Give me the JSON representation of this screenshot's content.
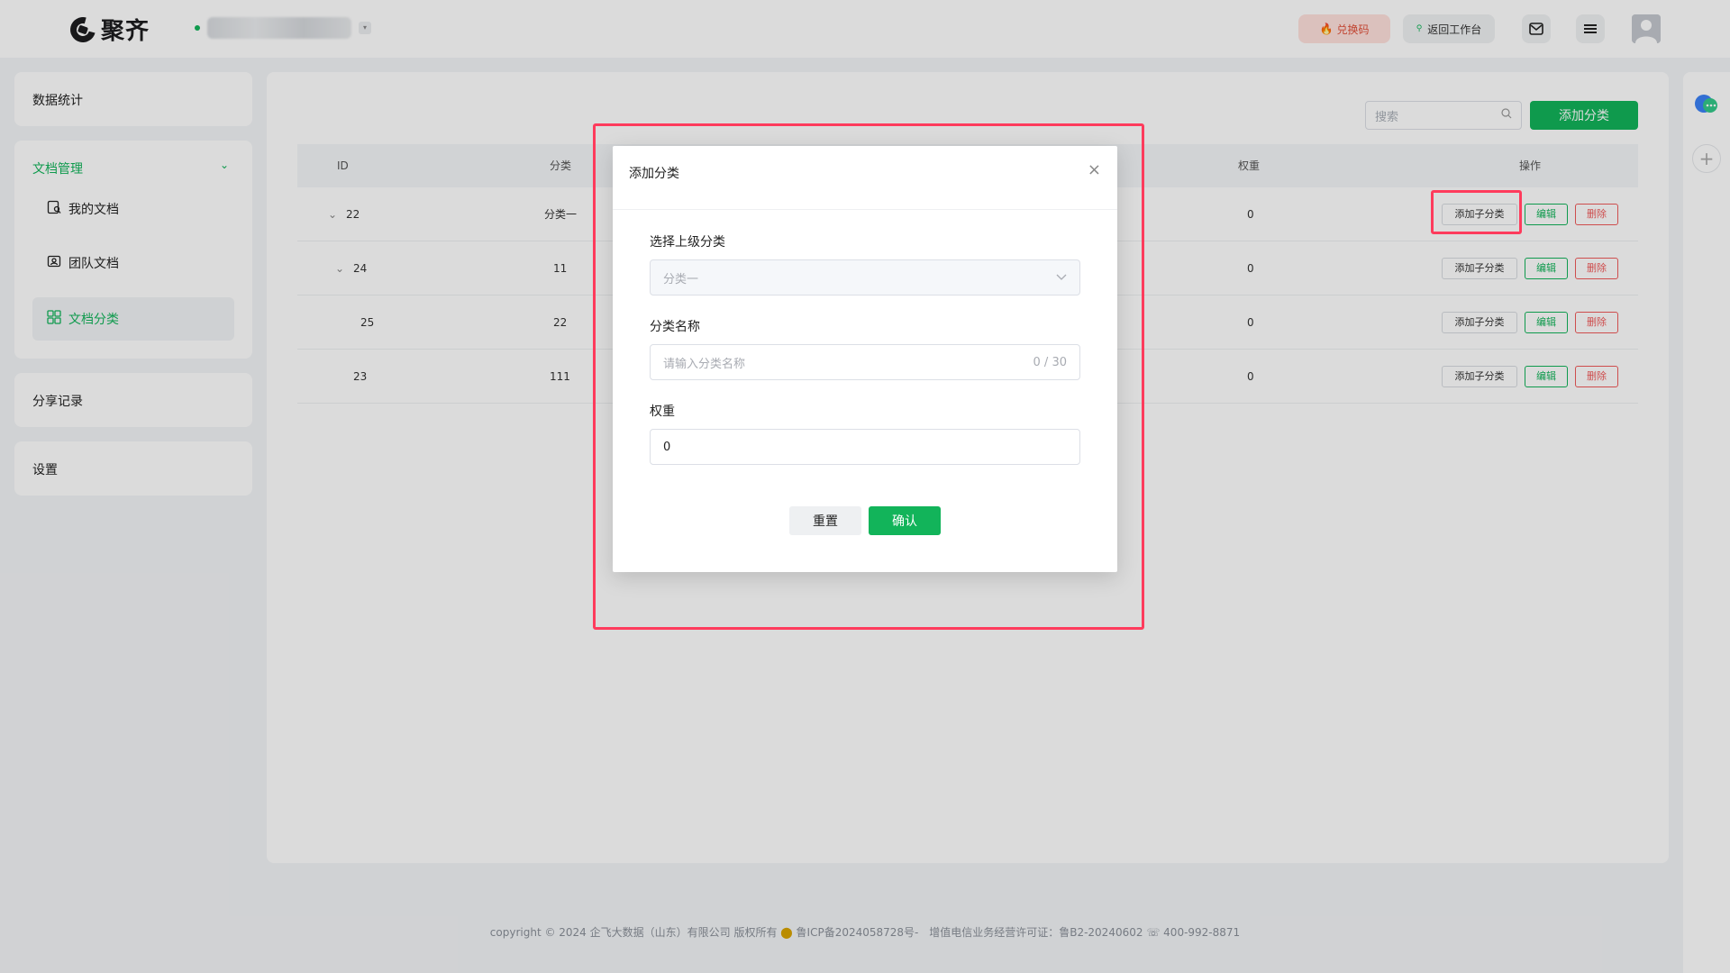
{
  "header": {
    "brand": "聚齐",
    "redeem_label": "兑换码",
    "back_label": "返回工作台"
  },
  "sidebar": {
    "stats": "数据统计",
    "doc_mgmt": "文档管理",
    "my_docs": "我的文档",
    "team_docs": "团队文档",
    "doc_category": "文档分类",
    "share_records": "分享记录",
    "settings": "设置"
  },
  "toolbar": {
    "search_placeholder": "搜索",
    "add_category": "添加分类"
  },
  "table": {
    "headers": {
      "id": "ID",
      "category": "分类",
      "weight": "权重",
      "actions": "操作"
    },
    "rows": [
      {
        "id": "22",
        "category": "分类一",
        "weight": "0",
        "expandable": true
      },
      {
        "id": "24",
        "category": "11",
        "weight": "0",
        "expandable": true
      },
      {
        "id": "25",
        "category": "22",
        "weight": "0",
        "expandable": false
      },
      {
        "id": "23",
        "category": "111",
        "weight": "0",
        "expandable": false
      }
    ],
    "action_labels": {
      "add_sub": "添加子分类",
      "edit": "编辑",
      "delete": "删除"
    }
  },
  "modal": {
    "title": "添加分类",
    "parent_label": "选择上级分类",
    "parent_value": "分类一",
    "name_label": "分类名称",
    "name_placeholder": "请输入分类名称",
    "name_counter": "0 / 30",
    "weight_label": "权重",
    "weight_value": "0",
    "reset_label": "重置",
    "confirm_label": "确认"
  },
  "footer": {
    "text": "copyright © 2024 企飞大数据（山东）有限公司 版权所有",
    "icp": "鲁ICP备2024058728号-",
    "license": "增值电信业务经营许可证：鲁B2-20240602",
    "phone": "400-992-8871"
  },
  "colors": {
    "accent": "#12b45a",
    "danger": "#f05a5a",
    "highlight": "#ff3b5c"
  }
}
